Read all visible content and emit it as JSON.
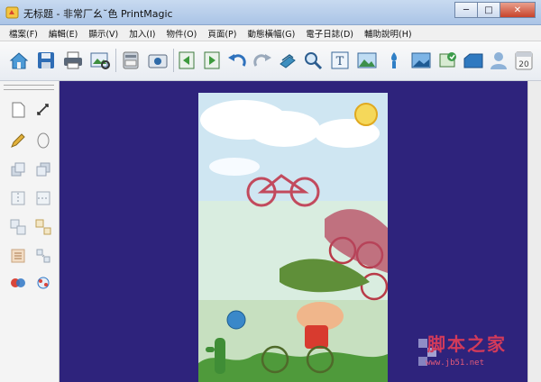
{
  "window": {
    "title": "无标题 - 非常厂幺˘色 PrintMagic",
    "controls": {
      "minimize": "─",
      "maximize": "□",
      "close": "✕"
    }
  },
  "menu": [
    {
      "label": "檔案(F)"
    },
    {
      "label": "編輯(E)"
    },
    {
      "label": "顯示(V)"
    },
    {
      "label": "加入(I)"
    },
    {
      "label": "物件(O)"
    },
    {
      "label": "頁面(P)"
    },
    {
      "label": "動態橫幅(G)"
    },
    {
      "label": "電子日誌(D)"
    },
    {
      "label": "輔助說明(H)"
    }
  ],
  "toolbar": [
    {
      "icon": "home-icon"
    },
    {
      "icon": "save-icon"
    },
    {
      "icon": "print-icon"
    },
    {
      "icon": "print-preview-icon"
    },
    {
      "icon": "scanner-icon"
    },
    {
      "icon": "camera-icon"
    },
    {
      "icon": "page-back-icon"
    },
    {
      "icon": "page-forward-icon"
    },
    {
      "icon": "undo-icon"
    },
    {
      "icon": "redo-icon"
    },
    {
      "icon": "layers-icon"
    },
    {
      "icon": "zoom-icon"
    },
    {
      "icon": "insert-text-icon"
    },
    {
      "icon": "insert-picture-icon"
    },
    {
      "icon": "insert-clipart-icon"
    },
    {
      "icon": "insert-photo-icon"
    },
    {
      "icon": "insert-frame-icon"
    },
    {
      "icon": "insert-shape-icon"
    },
    {
      "icon": "insert-person-icon"
    },
    {
      "icon": "calendar-icon",
      "text": "20"
    }
  ],
  "tools": [
    {
      "icon": "select-page-icon"
    },
    {
      "icon": "rotate-icon"
    },
    {
      "icon": "pencil-icon"
    },
    {
      "icon": "ellipse-icon"
    },
    {
      "icon": "bring-forward-icon"
    },
    {
      "icon": "send-backward-icon"
    },
    {
      "icon": "flip-horizontal-icon"
    },
    {
      "icon": "flip-vertical-icon"
    },
    {
      "icon": "group-icon"
    },
    {
      "icon": "ungroup-icon"
    },
    {
      "icon": "align-icon"
    },
    {
      "icon": "distribute-icon"
    },
    {
      "icon": "color-fill-icon"
    },
    {
      "icon": "effects-icon"
    }
  ],
  "watermark": {
    "title": "脚本之家",
    "url": "www.jb51.net"
  },
  "colors": {
    "workspace": "#2e237c",
    "titlebar": "#aac4e6",
    "accent": "#3e7bc4",
    "watermark": "#d23a5a"
  }
}
